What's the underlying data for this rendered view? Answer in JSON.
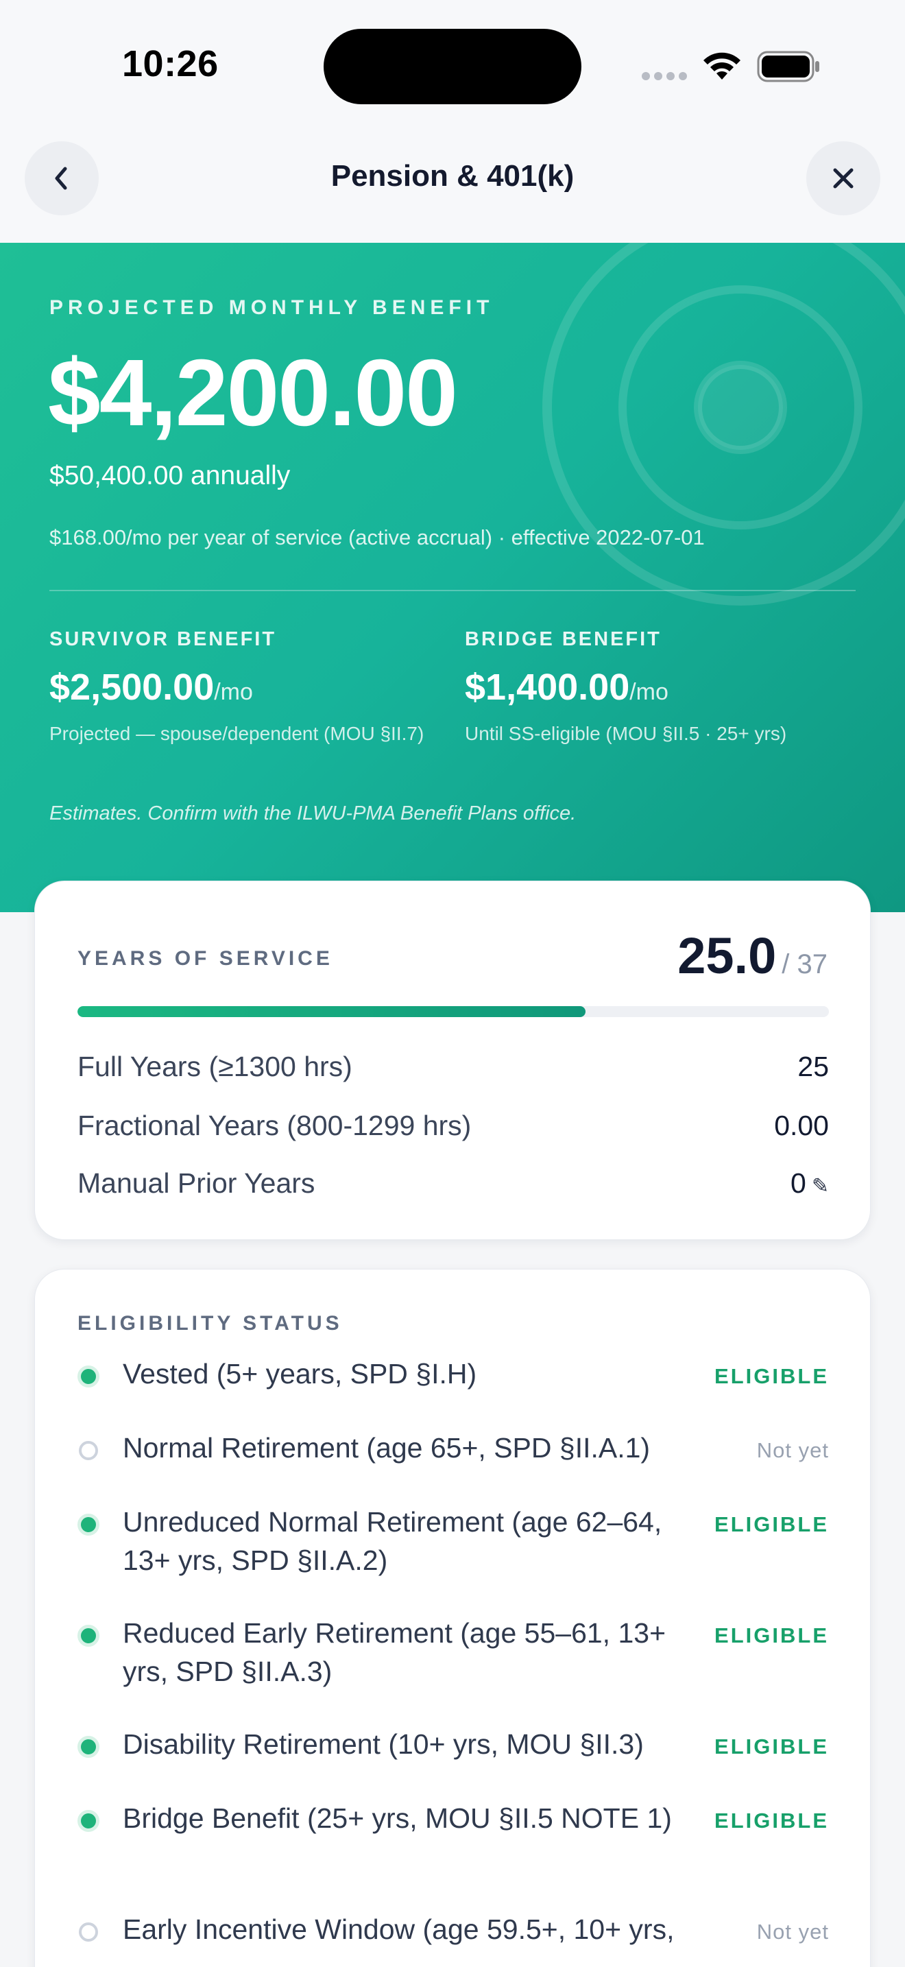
{
  "status_bar": {
    "time": "10:26"
  },
  "nav": {
    "title": "Pension & 401(k)"
  },
  "hero": {
    "label": "PROJECTED MONTHLY BENEFIT",
    "amount": "$4,200.00",
    "annual": "$50,400.00 annually",
    "accrual": "$168.00/mo per year of service (active accrual) · effective 2022-07-01",
    "survivor": {
      "label": "SURVIVOR BENEFIT",
      "amount": "$2,500.00",
      "unit": "/mo",
      "note": "Projected — spouse/dependent (MOU §II.7)"
    },
    "bridge": {
      "label": "BRIDGE BENEFIT",
      "amount": "$1,400.00",
      "unit": "/mo",
      "note": "Until SS-eligible (MOU §II.5 · 25+ yrs)"
    },
    "disclaimer": "Estimates. Confirm with the ILWU-PMA Benefit Plans office."
  },
  "service": {
    "label": "YEARS OF SERVICE",
    "years": "25.0",
    "total": "/ 37",
    "progress_fraction": 0.676,
    "rows": [
      {
        "key": "Full Years (≥1300 hrs)",
        "value": "25"
      },
      {
        "key": "Fractional Years (800-1299 hrs)",
        "value": "0.00"
      },
      {
        "key": "Manual Prior Years",
        "value": "0"
      }
    ]
  },
  "eligibility": {
    "label": "ELIGIBILITY STATUS",
    "items": [
      {
        "text": "Vested (5+ years, SPD §I.H)",
        "status": "ELIGIBLE",
        "eligible": true
      },
      {
        "text": "Normal Retirement (age 65+, SPD §II.A.1)",
        "status": "Not yet",
        "eligible": false
      },
      {
        "text": "Unreduced Normal Retirement (age 62–64, 13+ yrs, SPD §II.A.2)",
        "status": "ELIGIBLE",
        "eligible": true
      },
      {
        "text": "Reduced Early Retirement (age 55–61, 13+ yrs, SPD §II.A.3)",
        "status": "ELIGIBLE",
        "eligible": true
      },
      {
        "text": "Disability Retirement (10+ yrs, MOU §II.3)",
        "status": "ELIGIBLE",
        "eligible": true
      },
      {
        "text": "Bridge Benefit (25+ yrs, MOU §II.5 NOTE 1)",
        "status": "ELIGIBLE",
        "eligible": true
      },
      {
        "text": "Early Incentive Window (age 59.5+, 10+ yrs,",
        "status": "Not yet",
        "eligible": false
      }
    ]
  },
  "colors": {
    "hero_start": "#1fbf96",
    "hero_end": "#0f9882",
    "eligible": "#17a06a",
    "not_yet": "#98a1b0"
  }
}
